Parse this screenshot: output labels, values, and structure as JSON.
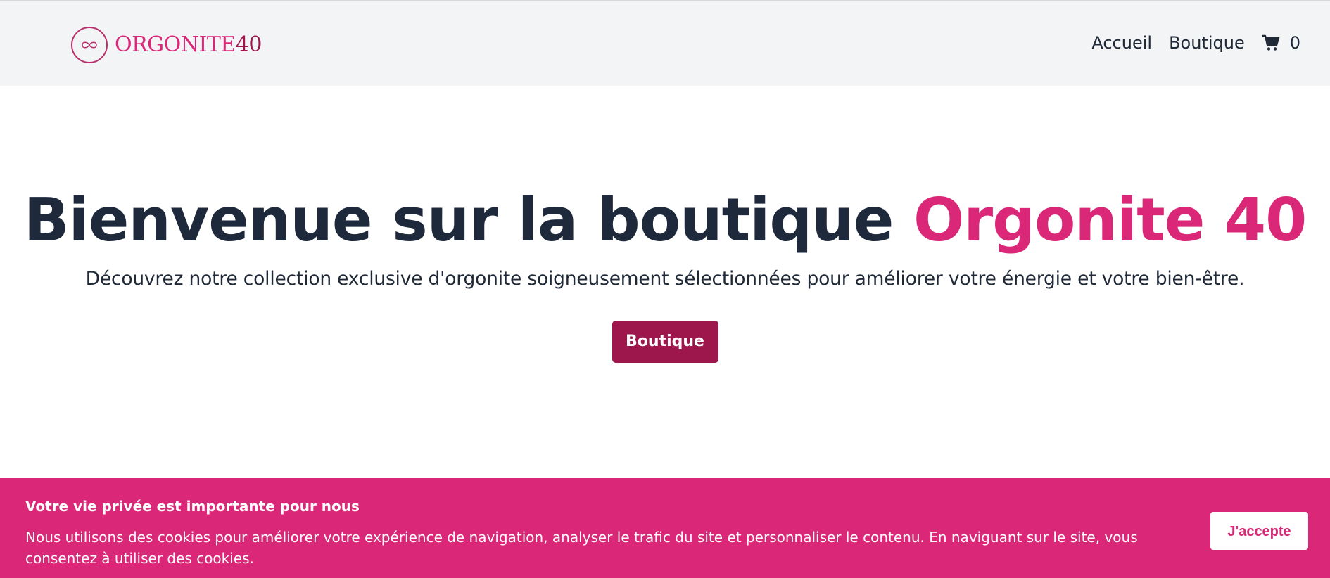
{
  "header": {
    "brand_part1": "ORGONITE",
    "brand_part2": "40",
    "logo_icon": "infinity-icon",
    "nav": [
      {
        "label": "Accueil"
      },
      {
        "label": "Boutique"
      }
    ],
    "cart_icon": "cart-icon",
    "cart_count": "0"
  },
  "hero": {
    "title_main": "Bienvenue sur la boutique",
    "title_accent": "Orgonite 40",
    "subtitle": "Découvrez notre collection exclusive d'orgonite soigneusement sélectionnées pour améliorer votre énergie et votre bien-être.",
    "button_label": "Boutique"
  },
  "cookie": {
    "title": "Votre vie privée est importante pour nous",
    "text": "Nous utilisons des cookies pour améliorer votre expérience de navigation, analyser le trafic du site et personnaliser le contenu. En naviguant sur le site, vous consentez à utiliser des cookies.",
    "accept_label": "J'accepte"
  },
  "colors": {
    "accent": "#db2777",
    "accent_dark": "#9d174d",
    "text_dark": "#1e293b",
    "nav_bg": "#f3f4f6"
  }
}
